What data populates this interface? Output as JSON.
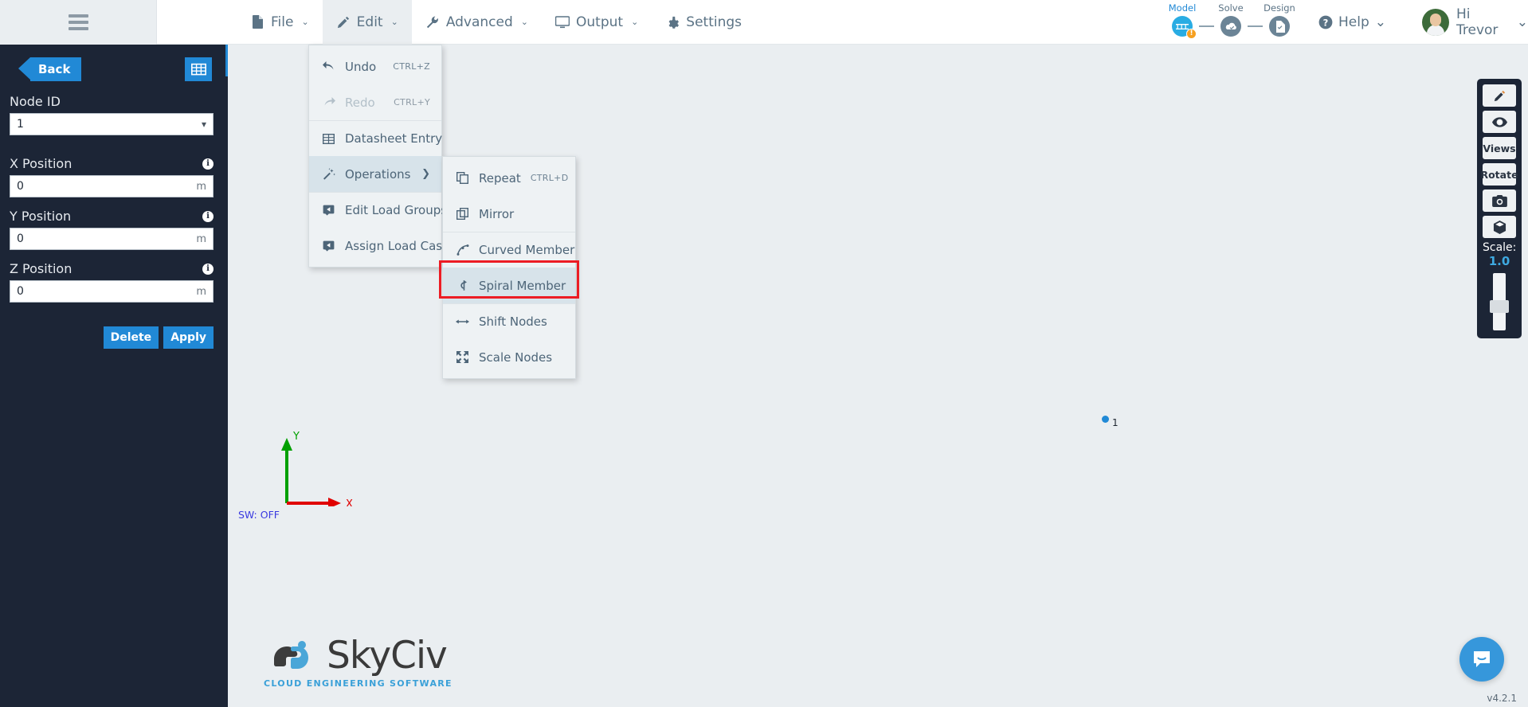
{
  "topbar": {
    "hamburger_icon": "hamburger-icon",
    "menu": [
      {
        "label": "File",
        "icon": "file-icon",
        "caret": "⌄",
        "active": false
      },
      {
        "label": "Edit",
        "icon": "pencil-icon",
        "caret": "⌄",
        "active": true
      },
      {
        "label": "Advanced",
        "icon": "wrench-icon",
        "caret": "⌄",
        "active": false
      },
      {
        "label": "Output",
        "icon": "monitor-icon",
        "caret": "⌄",
        "active": false
      },
      {
        "label": "Settings",
        "icon": "gear-icon",
        "caret": "",
        "active": false
      }
    ],
    "workflow": [
      {
        "label": "Model",
        "state": "active",
        "icon": "bridge-icon",
        "badge": "!"
      },
      {
        "label": "Solve",
        "state": "inactive",
        "icon": "cloud-check-icon",
        "badge": ""
      },
      {
        "label": "Design",
        "state": "inactive",
        "icon": "document-check-icon",
        "badge": ""
      }
    ],
    "help": {
      "label": "Help",
      "icon": "question-circle-icon",
      "caret": "⌄"
    },
    "user": {
      "label": "Hi Trevor",
      "icon": "avatar",
      "caret": "⌄"
    }
  },
  "sidebar": {
    "back_label": "Back",
    "grid_icon": "table-icon",
    "node_id": {
      "label": "Node ID",
      "value": "1"
    },
    "fields": [
      {
        "label": "X Position",
        "value": "0",
        "unit": "m",
        "info": "i"
      },
      {
        "label": "Y Position",
        "value": "0",
        "unit": "m",
        "info": "i"
      },
      {
        "label": "Z Position",
        "value": "0",
        "unit": "m",
        "info": "i"
      }
    ],
    "delete_label": "Delete",
    "apply_label": "Apply"
  },
  "edit_menu": [
    {
      "label": "Undo",
      "shortcut": "CTRL+Z",
      "icon": "undo-icon",
      "state": "normal",
      "submenu": false
    },
    {
      "label": "Redo",
      "shortcut": "CTRL+Y",
      "icon": "redo-icon",
      "state": "disabled",
      "submenu": false
    },
    {
      "label": "Datasheet Entry",
      "shortcut": "",
      "icon": "datasheet-icon",
      "state": "normal",
      "submenu": false
    },
    {
      "label": "Operations",
      "shortcut": "",
      "icon": "magic-wand-icon",
      "state": "highlighted",
      "submenu": true
    },
    {
      "label": "Edit Load Groups",
      "shortcut": "",
      "icon": "load-group-icon",
      "state": "normal",
      "submenu": false
    },
    {
      "label": "Assign Load Cases",
      "shortcut": "",
      "icon": "load-case-icon",
      "state": "normal",
      "submenu": false
    }
  ],
  "operations_menu": [
    {
      "label": "Repeat",
      "shortcut": "CTRL+D",
      "icon": "copy-icon",
      "state": "normal"
    },
    {
      "label": "Mirror",
      "shortcut": "",
      "icon": "mirror-icon",
      "state": "normal"
    },
    {
      "label": "Curved Member",
      "shortcut": "",
      "icon": "curved-member-icon",
      "state": "normal"
    },
    {
      "label": "Spiral Member",
      "shortcut": "",
      "icon": "spiral-member-icon",
      "state": "highlighted"
    },
    {
      "label": "Shift Nodes",
      "shortcut": "",
      "icon": "arrows-horizontal-icon",
      "state": "normal"
    },
    {
      "label": "Scale Nodes",
      "shortcut": "",
      "icon": "expand-icon",
      "state": "normal"
    }
  ],
  "canvas": {
    "sw_label": "SW: OFF",
    "node_label": "1",
    "axis_x_label": "X",
    "axis_y_label": "Y",
    "logo_text": "SkyCiv",
    "logo_tagline": "CLOUD ENGINEERING SOFTWARE",
    "version": "v4.2.1",
    "chat_icon": "chat-bubble-icon"
  },
  "right_toolbar": {
    "buttons": [
      {
        "label": "",
        "icon": "pencil-icon"
      },
      {
        "label": "",
        "icon": "eye-icon"
      },
      {
        "label": "Views",
        "icon": ""
      },
      {
        "label": "Rotate",
        "icon": ""
      },
      {
        "label": "",
        "icon": "camera-icon"
      },
      {
        "label": "",
        "icon": "cube-icon"
      }
    ],
    "scale_label": "Scale:",
    "scale_value": "1.0"
  },
  "colors": {
    "accent_blue": "#2189d6",
    "sidebar_dark": "#1c2536",
    "canvas_bg": "#eaeef1",
    "annotation_red": "#ec1c24",
    "menu_text": "#4d6578",
    "highlight": "#d7e3ea"
  }
}
